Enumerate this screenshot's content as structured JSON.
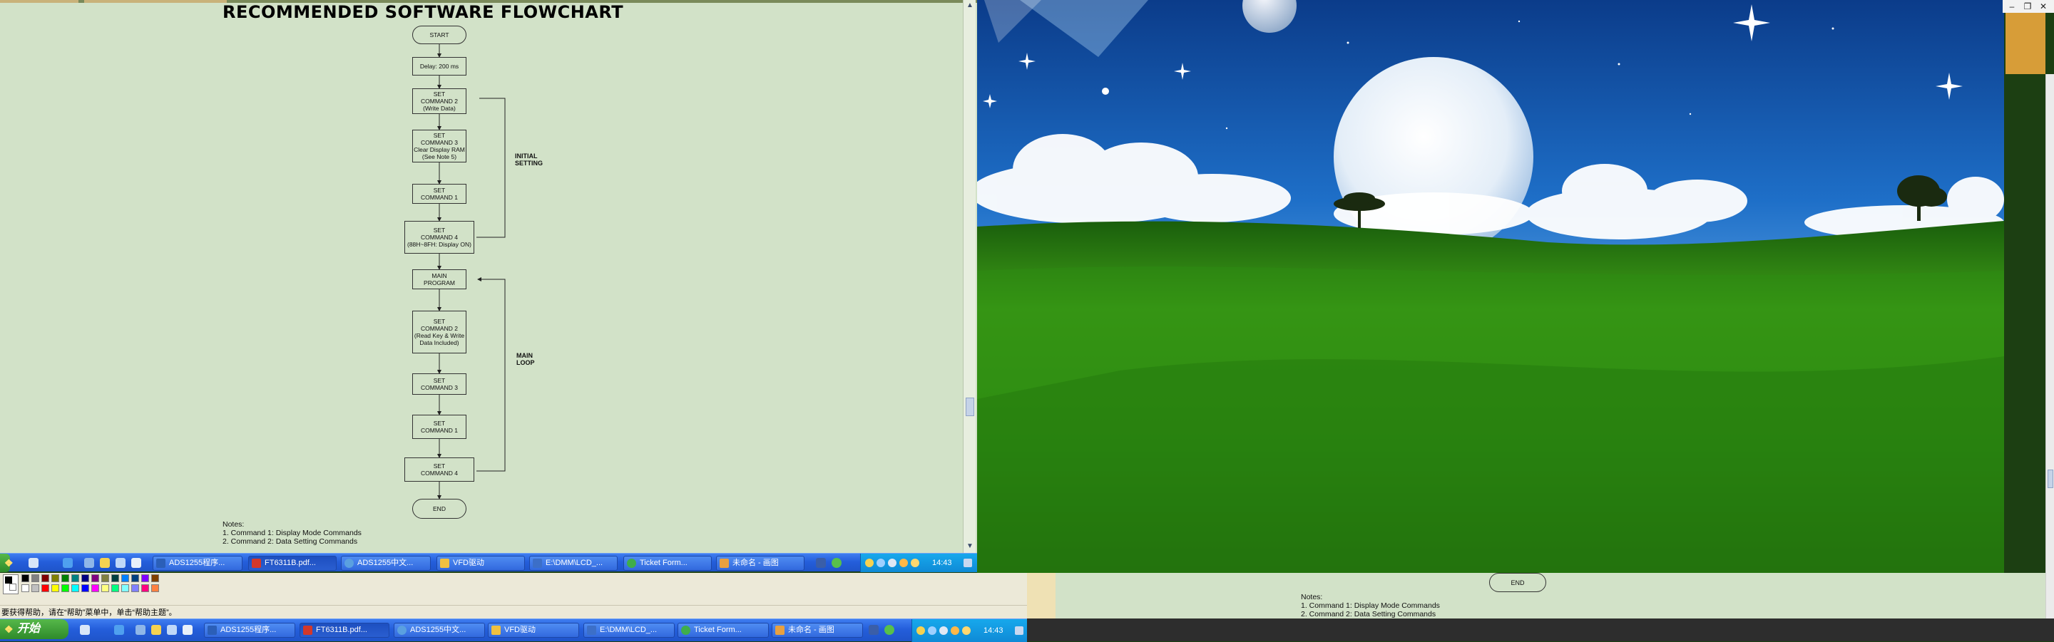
{
  "flowchart": {
    "title": "RECOMMENDED SOFTWARE FLOWCHART",
    "start": "START",
    "delay": "Delay: 200 ms",
    "box_cmd2_write": "SET\nCOMMAND 2\n(Write Data)",
    "box_cmd3_clear": "SET\nCOMMAND 3\nClear Display RAM\n(See Note 5)",
    "box_cmd1": "SET\nCOMMAND 1",
    "box_cmd4_display_on": "SET\nCOMMAND 4\n(88H~8FH: Display ON)",
    "main_program": "MAIN\nPROGRAM",
    "box_cmd2_readkey": "SET\nCOMMAND 2\n(Read Key & Write\nData Included)",
    "box_cmd3_loop": "SET\nCOMMAND 3",
    "box_cmd1_loop": "SET\nCOMMAND 1",
    "box_cmd4_loop": "SET\nCOMMAND 4",
    "end": "END",
    "initial_setting": "INITIAL\nSETTING",
    "main_loop": "MAIN\nLOOP"
  },
  "notes": {
    "heading": "Notes:",
    "note1": "1. Command 1: Display Mode Commands",
    "note2": "2. Command 2: Data Setting Commands"
  },
  "taskbar_upper": {
    "clock": "14:43",
    "buttons": [
      {
        "label": "ADS1255程序...",
        "icon_color": "#2b5fb8"
      },
      {
        "label": "FT6311B.pdf...",
        "icon_color": "#d4382a"
      },
      {
        "label": "ADS1255中文...",
        "icon_color": "#5aa0e0"
      },
      {
        "label": "VFD驱动",
        "icon_color": "#f0c040"
      },
      {
        "label": "E:\\DMM\\LCD_...",
        "icon_color": "#3c6fc8"
      },
      {
        "label": "Ticket Form...",
        "icon_color": "#3fae4a"
      },
      {
        "label": "未命名 - 画图",
        "icon_color": "#e8a040"
      }
    ]
  },
  "taskbar_lower": {
    "start_label": "开始",
    "clock": "14:43",
    "buttons": [
      {
        "label": "ADS1255程序...",
        "icon_color": "#2b5fb8"
      },
      {
        "label": "FT6311B.pdf...",
        "icon_color": "#d4382a"
      },
      {
        "label": "ADS1255中文...",
        "icon_color": "#5aa0e0"
      },
      {
        "label": "VFD驱动",
        "icon_color": "#f0c040"
      },
      {
        "label": "E:\\DMM\\LCD_...",
        "icon_color": "#3c6fc8"
      },
      {
        "label": "Ticket Form...",
        "icon_color": "#3fae4a"
      },
      {
        "label": "未命名 - 画图",
        "icon_color": "#e8a040"
      }
    ]
  },
  "paint": {
    "status": "要获得帮助，请在“帮助”菜单中，单击“帮助主题”。",
    "palette_top": [
      "#000000",
      "#808080",
      "#800000",
      "#808000",
      "#008000",
      "#008080",
      "#000080",
      "#800080",
      "#808040",
      "#004040",
      "#0080ff",
      "#004080",
      "#8000ff",
      "#804000"
    ],
    "palette_bottom": [
      "#ffffff",
      "#c0c0c0",
      "#ff0000",
      "#ffff00",
      "#00ff00",
      "#00ffff",
      "#0000ff",
      "#ff00ff",
      "#ffff80",
      "#00ff80",
      "#80ffff",
      "#8080ff",
      "#ff0080",
      "#ff8040"
    ]
  },
  "right_doc": {
    "end": "END",
    "notes_heading": "Notes:",
    "note1": "1. Command 1: Display Mode Commands",
    "note2": "2. Command 2: Data Setting Commands"
  },
  "window_controls": {
    "minimize": "–",
    "restore": "❐",
    "close": "✕"
  }
}
